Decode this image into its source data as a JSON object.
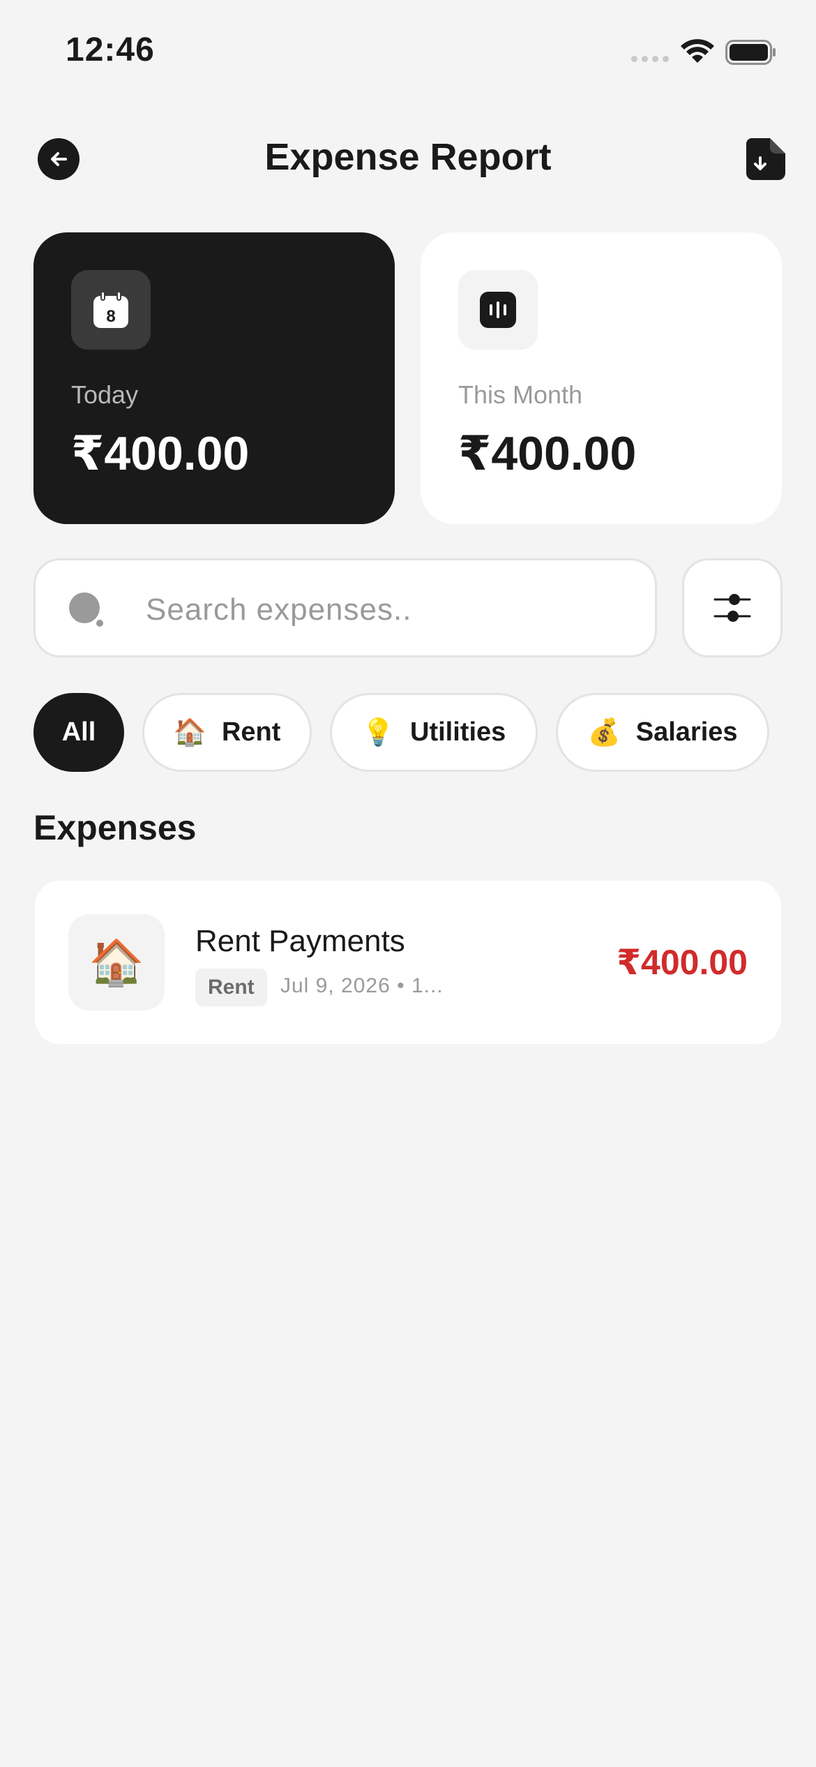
{
  "status_bar": {
    "time": "12:46"
  },
  "header": {
    "title": "Expense Report"
  },
  "summary": {
    "today": {
      "label": "Today",
      "value": "₹400.00",
      "icon": "calendar-icon",
      "icon_number": "8"
    },
    "month": {
      "label": "This Month",
      "value": "₹400.00",
      "icon": "bar-chart-icon"
    }
  },
  "search": {
    "placeholder": "Search expenses.."
  },
  "filters": [
    {
      "label": "All",
      "emoji": "",
      "active": true
    },
    {
      "label": "Rent",
      "emoji": "🏠",
      "active": false
    },
    {
      "label": "Utilities",
      "emoji": "💡",
      "active": false
    },
    {
      "label": "Salaries",
      "emoji": "💰",
      "active": false
    }
  ],
  "expenses_section": {
    "title": "Expenses",
    "items": [
      {
        "emoji": "🏠",
        "title": "Rent Payments",
        "tag": "Rent",
        "meta": "Jul 9, 2026  •  1...",
        "amount": "₹400.00"
      }
    ]
  },
  "colors": {
    "accent_dark": "#1a1a1a",
    "amount_negative": "#d12b2b",
    "background": "#f4f4f4"
  }
}
